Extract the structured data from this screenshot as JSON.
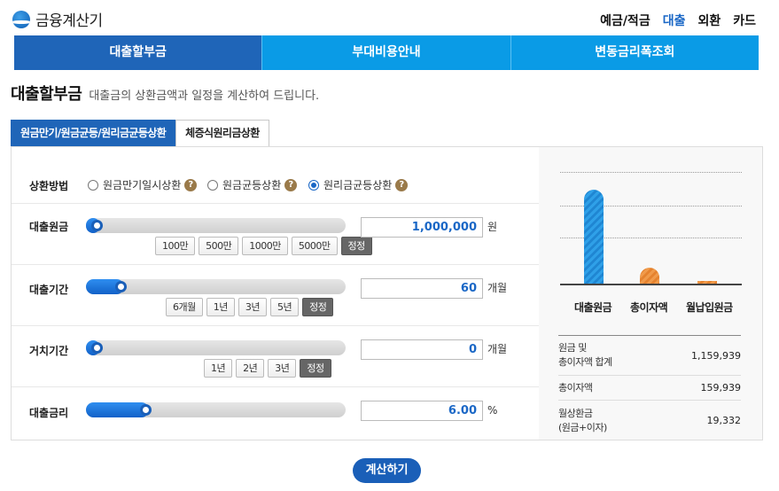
{
  "app_title": "금융계산기",
  "topnav": [
    "예금/적금",
    "대출",
    "외환",
    "카드"
  ],
  "mainnav": [
    "대출할부금",
    "부대비용안내",
    "변동금리폭조회"
  ],
  "page": {
    "title": "대출할부금",
    "desc": "대출금의 상환금액과 일정을 계산하여 드립니다."
  },
  "subtabs": [
    "원금만기/원금균등/원리금균등상환",
    "체증식원리금상환"
  ],
  "repay": {
    "label": "상환방법",
    "options": [
      "원금만기일시상환",
      "원금균등상환",
      "원리금균등상환"
    ],
    "selected": "원리금균등상환",
    "help": "?"
  },
  "principal": {
    "label": "대출원금",
    "value": "1,000,000",
    "unit": "원",
    "slider": 0.0,
    "buttons": [
      "100만",
      "500만",
      "1000만",
      "5000만",
      "정정"
    ]
  },
  "period": {
    "label": "대출기간",
    "value": "60",
    "unit": "개월",
    "slider": 0.1,
    "buttons": [
      "6개월",
      "1년",
      "3년",
      "5년",
      "정정"
    ]
  },
  "grace": {
    "label": "거치기간",
    "value": "0",
    "unit": "개월",
    "slider": 0.0,
    "buttons": [
      "1년",
      "2년",
      "3년",
      "정정"
    ]
  },
  "rate": {
    "label": "대출금리",
    "value": "6.00",
    "unit": "%",
    "slider": 0.2
  },
  "chart_data": {
    "type": "bar",
    "categories": [
      "대출원금",
      "총이자액",
      "월납입원금"
    ],
    "values": [
      1000000,
      159939,
      19332
    ],
    "colors": [
      "#2fa0e8",
      "#f09a4a",
      "#f09a4a"
    ]
  },
  "summary": [
    {
      "label1": "원금 및",
      "label2": "총이자액 합계",
      "value": "1,159,939"
    },
    {
      "label1": "총이자액",
      "label2": "",
      "value": "159,939"
    },
    {
      "label1": "월상환금",
      "label2": "(원금+이자)",
      "value": "19,332"
    }
  ],
  "calc_button": "계산하기"
}
